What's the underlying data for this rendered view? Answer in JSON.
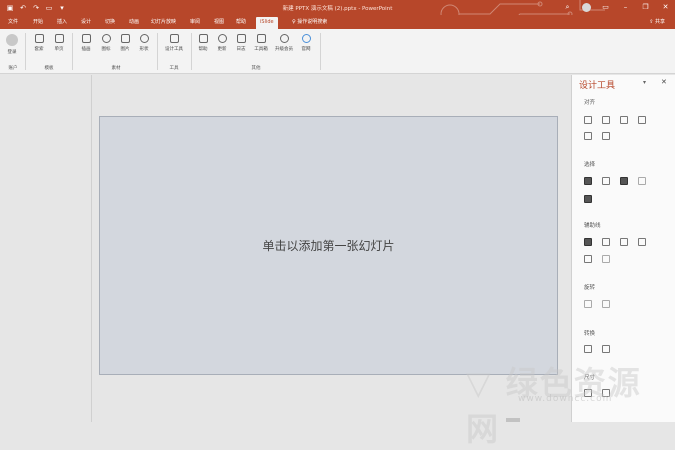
{
  "window": {
    "title": "新建 PPTX 演示文稿 (2).pptx - PowerPoint",
    "share_label": "共享"
  },
  "tabs": [
    {
      "label": "文件"
    },
    {
      "label": "开始"
    },
    {
      "label": "插入"
    },
    {
      "label": "设计"
    },
    {
      "label": "切换"
    },
    {
      "label": "动画"
    },
    {
      "label": "幻灯片放映"
    },
    {
      "label": "审阅"
    },
    {
      "label": "视图"
    },
    {
      "label": "帮助"
    },
    {
      "label": "iSlide"
    }
  ],
  "tell_me": "操作说明搜索",
  "ribbon": {
    "groups": [
      {
        "label": "账户",
        "buttons": [
          "登录"
        ]
      },
      {
        "label": "模板",
        "buttons": [
          "套索",
          "单页"
        ]
      },
      {
        "label": "素材",
        "buttons": [
          "插画",
          "图标",
          "图片",
          "形状"
        ]
      },
      {
        "label": "工具",
        "buttons": [
          "设计工具"
        ]
      },
      {
        "label": "其他",
        "buttons": [
          "帮助",
          "更新",
          "日志",
          "工具箱",
          "升级会员",
          "官网"
        ]
      }
    ]
  },
  "slide": {
    "placeholder": "单击以添加第一张幻灯片"
  },
  "pane": {
    "title": "设计工具",
    "sections": [
      {
        "label": "对齐"
      },
      {
        "label": "选择"
      },
      {
        "label": "辅助线"
      },
      {
        "label": "旋转"
      },
      {
        "label": "转换"
      },
      {
        "label": "尺寸"
      }
    ]
  },
  "colors": {
    "accent": "#b7472a",
    "slide_bg": "#d3d7de"
  }
}
